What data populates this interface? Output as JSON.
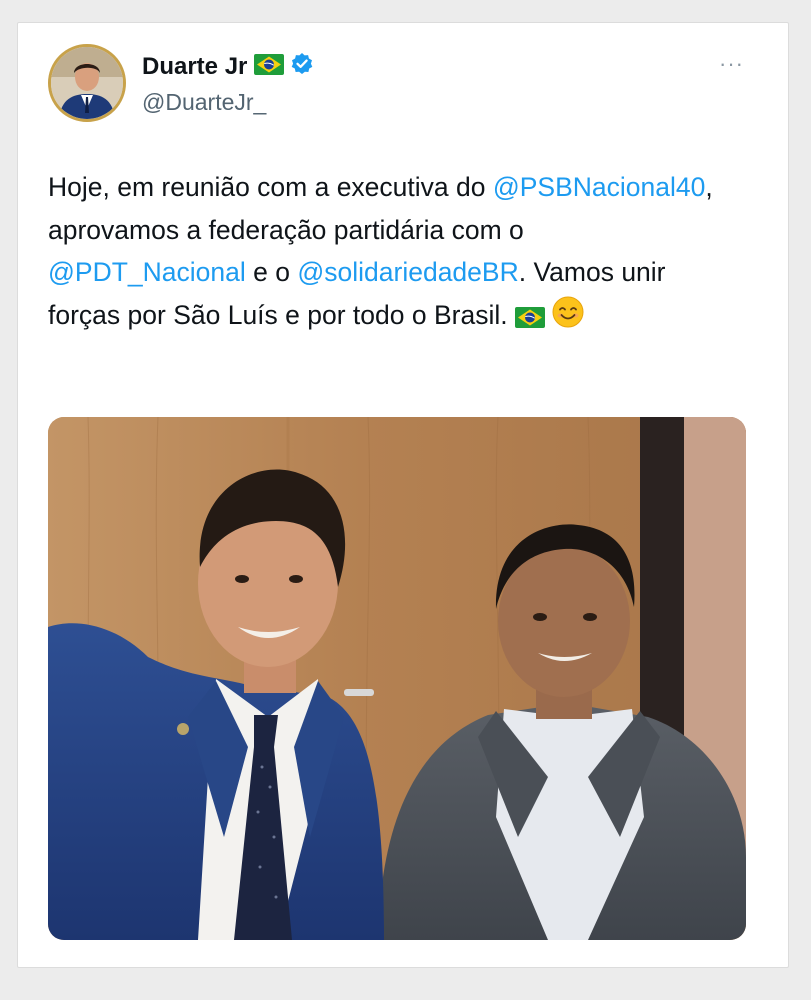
{
  "tweet": {
    "author_name": "Duarte Jr",
    "handle": "@DuarteJr_",
    "more_label": "···",
    "text": {
      "t1": "Hoje, em reunião com a executiva do",
      "m1": "@PSBNacional40",
      "t2": ", aprovamos a federação partidária com o",
      "m2": "@PDT_Nacional",
      "t3": "e o",
      "m3": "@solidariedadeBR",
      "t4": ". Vamos unir forças por São Luís e por todo o Brasil."
    }
  },
  "icons": {
    "author_flag": "brazil-flag-icon",
    "verified": "verified-badge-icon",
    "more": "more-options-icon",
    "text_flag": "brazil-flag-icon",
    "text_emoji": "smiling-face-emoji"
  },
  "colors": {
    "link": "#1d9bf0",
    "text": "#0f1419",
    "secondary": "#536471",
    "verified": "#1d9bf0"
  }
}
